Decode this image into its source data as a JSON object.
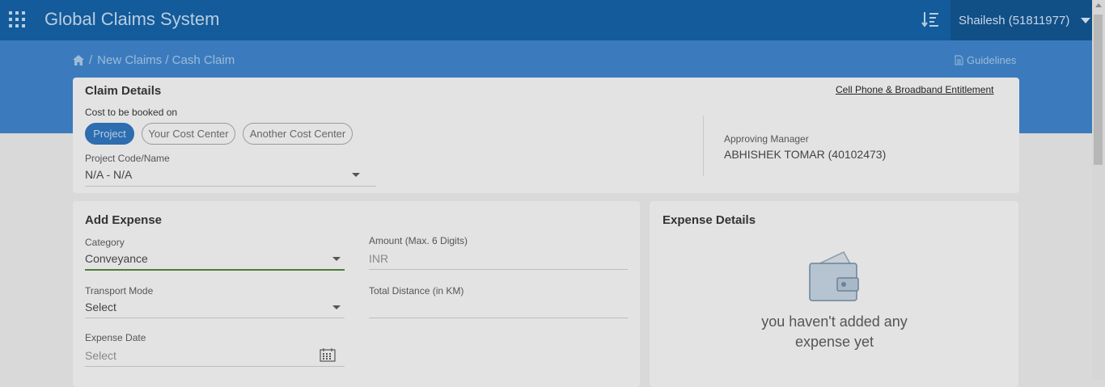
{
  "header": {
    "app_title": "Global Claims System",
    "user": "Shailesh (51811977)",
    "icons": [
      "apps-grid-icon",
      "sort-list-icon",
      "chevron-down-icon"
    ]
  },
  "breadcrumb": {
    "separator": "/",
    "path": "New Claims / Cash Claim",
    "guidelines_label": "Guidelines"
  },
  "claim_details": {
    "title": "Claim Details",
    "entitlement_link": "Cell Phone & Broadband Entitlement",
    "cost_label": "Cost to be booked on",
    "cost_options": [
      {
        "label": "Project",
        "selected": true
      },
      {
        "label": "Your Cost Center",
        "selected": false
      },
      {
        "label": "Another Cost Center",
        "selected": false
      }
    ],
    "project_label": "Project Code/Name",
    "project_value": "N/A - N/A",
    "manager_label": "Approving Manager",
    "manager_value": "ABHISHEK TOMAR (40102473)"
  },
  "add_expense": {
    "title": "Add Expense",
    "category_label": "Category",
    "category_value": "Conveyance",
    "amount_label": "Amount (Max. 6 Digits)",
    "amount_placeholder": "INR",
    "transport_label": "Transport Mode",
    "transport_value": "Select",
    "distance_label": "Total Distance (in KM)",
    "distance_value": "",
    "date_label": "Expense Date",
    "date_placeholder": "Select"
  },
  "expense_details": {
    "title": "Expense Details",
    "empty_message": "you haven't added any expense yet"
  },
  "colors": {
    "header_bg": "#135b9a",
    "hero_bg": "#3b7bbd",
    "accent": "#2d6db0",
    "category_underline": "#4a7d3a"
  }
}
